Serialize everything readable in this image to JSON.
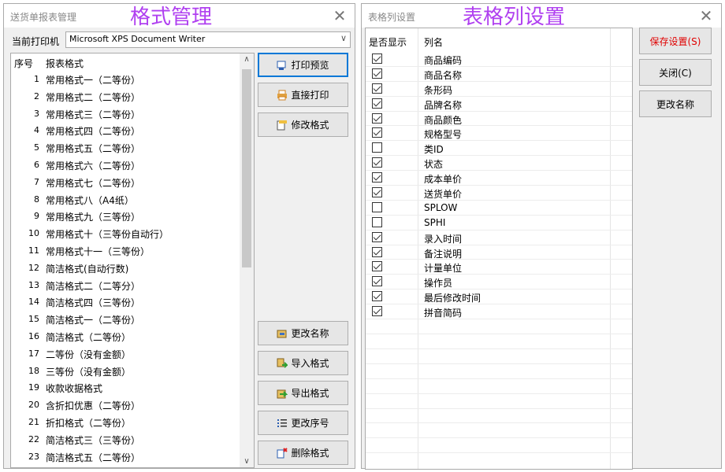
{
  "left_window": {
    "title": "送货单报表管理",
    "overlay_label": "格式管理",
    "close_glyph": "✕",
    "printer_label": "当前打印机",
    "printer_value": "Microsoft XPS Document Writer",
    "list_headers": {
      "num": "序号",
      "name": "报表格式"
    },
    "formats": [
      {
        "num": "1",
        "name": "常用格式一（二等份）"
      },
      {
        "num": "2",
        "name": "常用格式二（二等份）"
      },
      {
        "num": "3",
        "name": "常用格式三（二等份）"
      },
      {
        "num": "4",
        "name": "常用格式四（二等份）"
      },
      {
        "num": "5",
        "name": "常用格式五（二等份）"
      },
      {
        "num": "6",
        "name": "常用格式六（二等份）"
      },
      {
        "num": "7",
        "name": "常用格式七（二等份）"
      },
      {
        "num": "8",
        "name": "常用格式八（A4纸）"
      },
      {
        "num": "9",
        "name": "常用格式九（三等份）"
      },
      {
        "num": "10",
        "name": "常用格式十（三等份自动行）"
      },
      {
        "num": "11",
        "name": "常用格式十一（三等份）"
      },
      {
        "num": "12",
        "name": "简洁格式(自动行数)"
      },
      {
        "num": "13",
        "name": "简洁格式二（二等分）"
      },
      {
        "num": "14",
        "name": "简洁格式四（三等份）"
      },
      {
        "num": "15",
        "name": "简洁格式一（二等份）"
      },
      {
        "num": "16",
        "name": "简洁格式（二等份）"
      },
      {
        "num": "17",
        "name": "二等份（没有金额）"
      },
      {
        "num": "18",
        "name": "三等份（没有金额）"
      },
      {
        "num": "19",
        "name": "收款收据格式"
      },
      {
        "num": "20",
        "name": "含折扣优惠（二等份）"
      },
      {
        "num": "21",
        "name": "折扣格式（二等份）"
      },
      {
        "num": "22",
        "name": "简洁格式三（三等份）"
      },
      {
        "num": "23",
        "name": "简洁格式五（二等份）"
      }
    ],
    "buttons": {
      "preview": "打印预览",
      "direct_print": "直接打印",
      "modify_format": "修改格式",
      "rename": "更改名称",
      "import": "导入格式",
      "export": "导出格式",
      "reorder": "更改序号",
      "delete": "删除格式"
    }
  },
  "right_window": {
    "title": "表格列设置",
    "overlay_label": "表格列设置",
    "close_glyph": "✕",
    "headers": {
      "show": "是否显示",
      "col": "列名"
    },
    "columns": [
      {
        "name": "商品编码",
        "checked": true
      },
      {
        "name": "商品名称",
        "checked": true
      },
      {
        "name": "条形码",
        "checked": true
      },
      {
        "name": "品牌名称",
        "checked": true
      },
      {
        "name": "商品颜色",
        "checked": true
      },
      {
        "name": "规格型号",
        "checked": true
      },
      {
        "name": "类ID",
        "checked": false
      },
      {
        "name": "状态",
        "checked": true
      },
      {
        "name": "成本单价",
        "checked": true
      },
      {
        "name": "送货单价",
        "checked": true
      },
      {
        "name": "SPLOW",
        "checked": false
      },
      {
        "name": "SPHI",
        "checked": false
      },
      {
        "name": "录入时间",
        "checked": true
      },
      {
        "name": "备注说明",
        "checked": true
      },
      {
        "name": "计量单位",
        "checked": true
      },
      {
        "name": "操作员",
        "checked": true
      },
      {
        "name": "最后修改时间",
        "checked": true
      },
      {
        "name": "拼音简码",
        "checked": true
      }
    ],
    "buttons": {
      "save": "保存设置(S)",
      "close": "关闭(C)",
      "rename": "更改名称"
    }
  },
  "colors": {
    "overlay": "#b040f0",
    "save_text": "#e00000",
    "primary_border": "#0078d7"
  }
}
